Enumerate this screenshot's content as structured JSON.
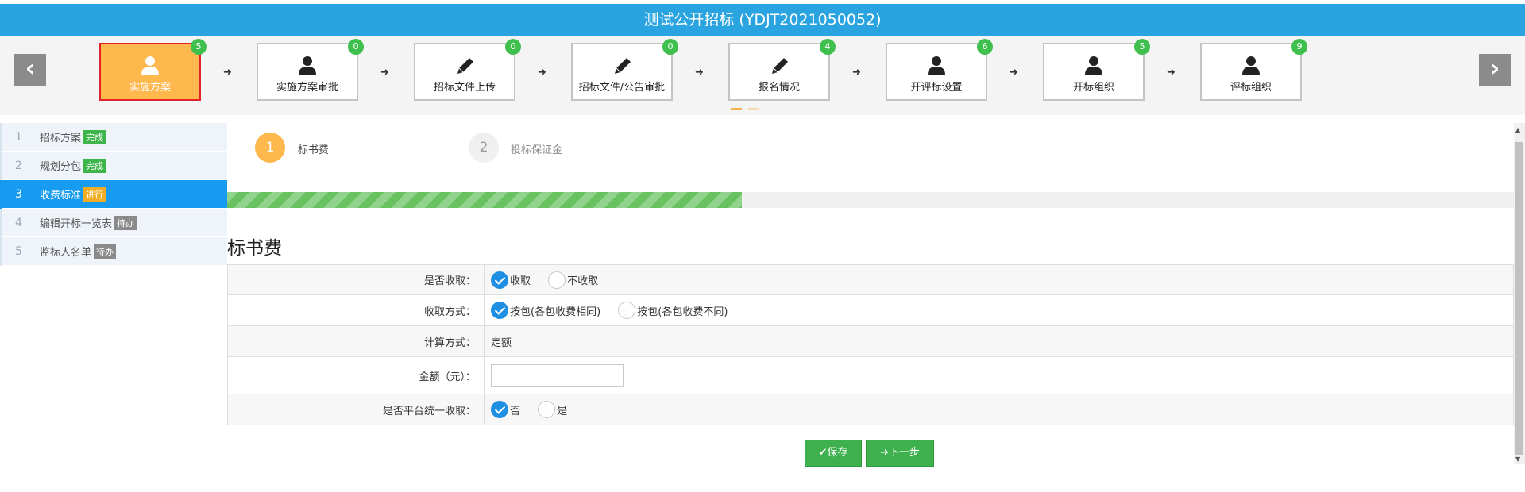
{
  "title": "测试公开招标 (YDJT2021050052)",
  "nav": {
    "prev_label": "‹",
    "next_label": "›",
    "arrow_glyph": "➜",
    "steps": [
      {
        "label": "实施方案",
        "badge": "5",
        "icon": "user-icon",
        "active": true
      },
      {
        "label": "实施方案审批",
        "badge": "0",
        "icon": "user-icon",
        "active": false
      },
      {
        "label": "招标文件上传",
        "badge": "0",
        "icon": "pencil-icon",
        "active": false
      },
      {
        "label": "招标文件/公告审批",
        "badge": "0",
        "icon": "pencil-icon",
        "active": false
      },
      {
        "label": "报名情况",
        "badge": "4",
        "icon": "pencil-icon",
        "active": false
      },
      {
        "label": "开评标设置",
        "badge": "6",
        "icon": "user-icon",
        "active": false
      },
      {
        "label": "开标组织",
        "badge": "5",
        "icon": "user-icon",
        "active": false
      },
      {
        "label": "评标组织",
        "badge": "9",
        "icon": "user-icon",
        "active": false
      }
    ]
  },
  "sidebar": {
    "items": [
      {
        "num": "1",
        "label": "招标方案",
        "tag": "完成",
        "status": "done"
      },
      {
        "num": "2",
        "label": "规划分包",
        "tag": "完成",
        "status": "done"
      },
      {
        "num": "3",
        "label": "收费标准",
        "tag": "进行",
        "status": "doing"
      },
      {
        "num": "4",
        "label": "编辑开标一览表",
        "tag": "待办",
        "status": "todo"
      },
      {
        "num": "5",
        "label": "监标人名单",
        "tag": "待办",
        "status": "todo"
      }
    ]
  },
  "substeps": [
    {
      "num": "1",
      "label": "标书费",
      "active": true
    },
    {
      "num": "2",
      "label": "投标保证金",
      "active": false
    }
  ],
  "progress": 0.4,
  "section_title": "标书费",
  "form": {
    "collect_label": "是否收取：",
    "collect_options": [
      "收取",
      "不收取"
    ],
    "method_label": "收取方式：",
    "method_options": [
      "按包(各包收费相同)",
      "按包(各包收费不同)"
    ],
    "calc_label": "计算方式：",
    "calc_value": "定额",
    "amount_label": "金额（元）：",
    "amount_value": "",
    "platform_label": "是否平台统一收取：",
    "platform_options": [
      "否",
      "是"
    ]
  },
  "buttons": {
    "save": "保存",
    "next": "下一步"
  },
  "colors": {
    "header": "#29a4e0",
    "active_step": "#ffb84d",
    "badge": "#3fbf4e",
    "sidebar_active": "#169bf0",
    "progress": "#67c25f",
    "button": "#3eb14e"
  }
}
